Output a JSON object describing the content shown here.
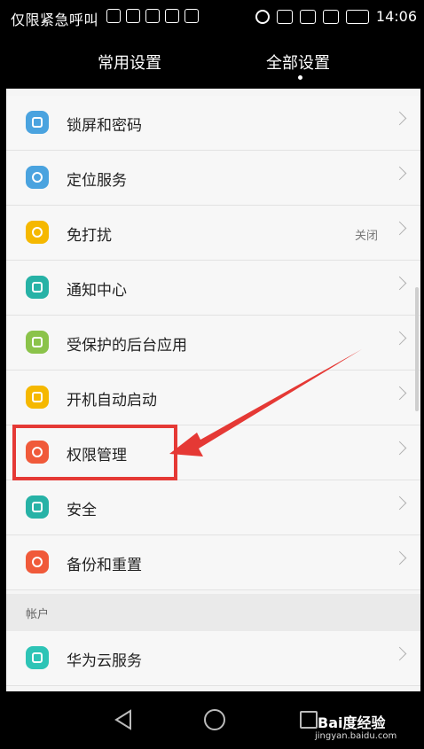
{
  "status_bar": {
    "carrier": "仅限紧急呼叫",
    "time": "14:06"
  },
  "tabs": [
    {
      "label": "常用设置"
    },
    {
      "label": "全部设置"
    }
  ],
  "settings": [
    {
      "label": "锁屏和密码",
      "icon": "lock-icon",
      "color": "#4aa3df"
    },
    {
      "label": "定位服务",
      "icon": "location-icon",
      "color": "#4aa3df"
    },
    {
      "label": "免打扰",
      "icon": "moon-icon",
      "color": "#f5b800",
      "value": "关闭"
    },
    {
      "label": "通知中心",
      "icon": "notification-icon",
      "color": "#27b2a6"
    },
    {
      "label": "受保护的后台应用",
      "icon": "apps-icon",
      "color": "#8bc34a"
    },
    {
      "label": "开机自动启动",
      "icon": "power-icon",
      "color": "#f5b800"
    },
    {
      "label": "权限管理",
      "icon": "permission-icon",
      "color": "#f05a3a"
    },
    {
      "label": "安全",
      "icon": "shield-icon",
      "color": "#27b2a6"
    },
    {
      "label": "备份和重置",
      "icon": "backup-icon",
      "color": "#f05a3a"
    }
  ],
  "account_section": {
    "title": "帐户",
    "items": [
      {
        "label": "华为云服务",
        "icon": "cloud-icon",
        "color": "#2ec4b6"
      }
    ]
  },
  "watermark": {
    "brand": "Bai度经验",
    "url": "jingyan.baidu.com"
  },
  "colors": {
    "highlight": "#e53935",
    "background": "#f7f7f7"
  }
}
